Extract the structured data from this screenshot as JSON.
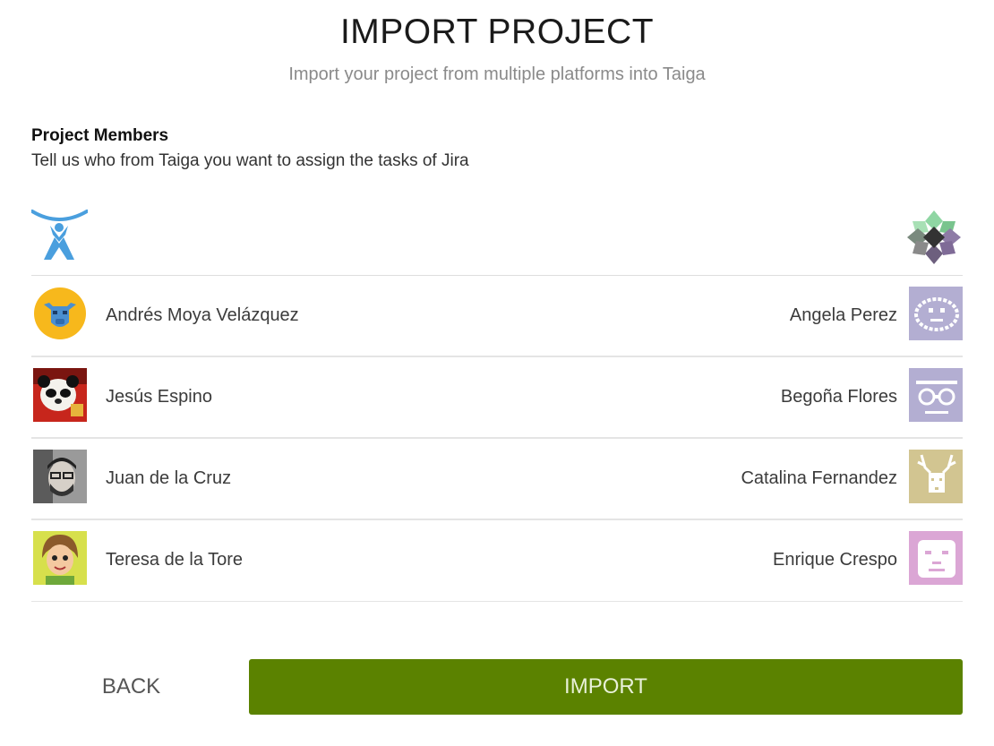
{
  "header": {
    "title": "IMPORT PROJECT",
    "subtitle": "Import your project from multiple platforms into Taiga"
  },
  "section": {
    "title": "Project Members",
    "description": "Tell us who from Taiga you want to assign the tasks of Jira"
  },
  "logos": {
    "source": "jira-logo-icon",
    "target": "taiga-logo-icon"
  },
  "members": [
    {
      "source_name": "Andrés Moya Velázquez",
      "source_avatar": "blue-bull-avatar",
      "target_name": "Angela Perez",
      "target_avatar": "pixel-face-lavender"
    },
    {
      "source_name": "Jesús Espino",
      "source_avatar": "panda-avatar",
      "target_name": "Begoña Flores",
      "target_avatar": "pixel-owl-lavender"
    },
    {
      "source_name": "Juan de la Cruz",
      "source_avatar": "bearded-man-photo-avatar",
      "target_name": "Catalina Fernandez",
      "target_avatar": "pixel-deer-khaki"
    },
    {
      "source_name": "Teresa de la Tore",
      "source_avatar": "cartoon-girl-avatar",
      "target_name": "Enrique Crespo",
      "target_avatar": "pixel-face-pink"
    }
  ],
  "footer": {
    "back_label": "BACK",
    "import_label": "IMPORT"
  },
  "colors": {
    "import_button": "#5b8200",
    "jira_blue": "#4a9fde",
    "divider": "#e4e4e4"
  }
}
